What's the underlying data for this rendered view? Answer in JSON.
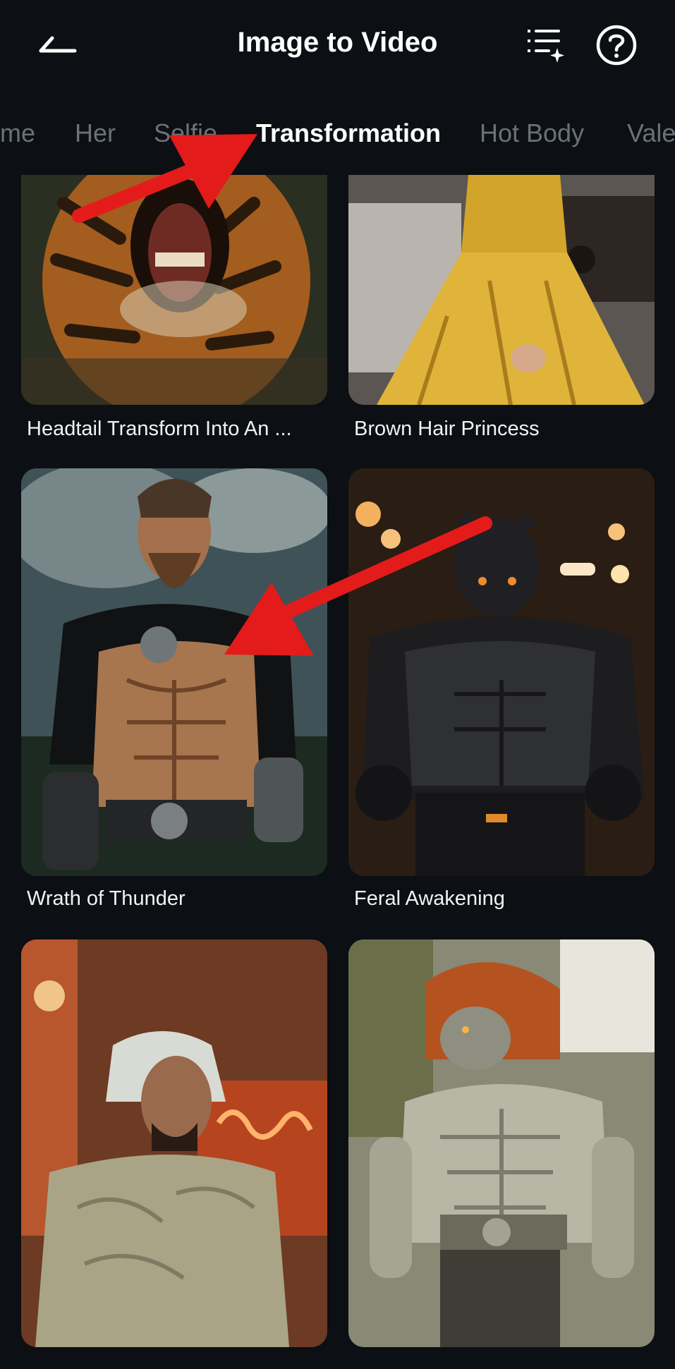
{
  "header": {
    "title": "Image to Video",
    "back_icon": "back-arrow-icon",
    "list_icon": "sparkle-list-icon",
    "help_icon": "help-circle-icon"
  },
  "tabs": [
    {
      "label": "me"
    },
    {
      "label": "Her"
    },
    {
      "label": "Selfie"
    },
    {
      "label": "Transformation",
      "active": true
    },
    {
      "label": "Hot Body"
    },
    {
      "label": "Vale"
    }
  ],
  "cards": [
    {
      "label": ""
    },
    {
      "label": ""
    },
    {
      "label": "Headtail Transform Into An ..."
    },
    {
      "label": "Brown Hair Princess"
    },
    {
      "label": "Wrath of Thunder"
    },
    {
      "label": "Feral Awakening"
    },
    {
      "label": ""
    },
    {
      "label": ""
    }
  ],
  "colors": {
    "background": "#0c0f13",
    "active_tab": "#ffffff",
    "inactive_tab": "#6b717a",
    "annotation_arrow": "#e31b1b"
  }
}
